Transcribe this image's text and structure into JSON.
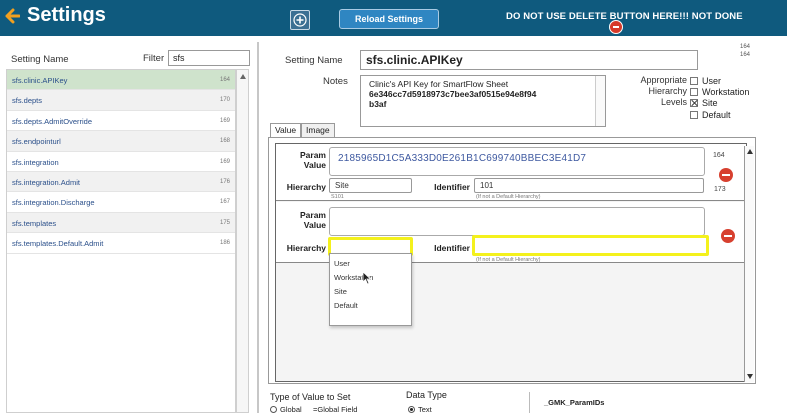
{
  "header": {
    "title": "Settings",
    "reload_label": "Reload Settings",
    "warning": "DO NOT USE DELETE BUTTON HERE!!! NOT DONE"
  },
  "left": {
    "col_label": "Setting Name",
    "filter_label": "Filter",
    "filter_value": "sfs",
    "items": [
      {
        "name": "sfs.clinic.APIKey",
        "num": "164"
      },
      {
        "name": "sfs.depts",
        "num": "170"
      },
      {
        "name": "sfs.depts.AdmitOverride",
        "num": "169"
      },
      {
        "name": "sfs.endpointurl",
        "num": "168"
      },
      {
        "name": "sfs.integration",
        "num": "169"
      },
      {
        "name": "sfs.integration.Admit",
        "num": "176"
      },
      {
        "name": "sfs.integration.Discharge",
        "num": "167"
      },
      {
        "name": "sfs.templates",
        "num": "175"
      },
      {
        "name": "sfs.templates.Default.Admit",
        "num": "186"
      }
    ]
  },
  "detail": {
    "setting_name_label": "Setting Name",
    "setting_name": "sfs.clinic.APIKey",
    "id_top": "164",
    "id_bottom": "164",
    "notes_label": "Notes",
    "notes_line1": "Clinic's API Key for SmartFlow Sheet",
    "notes_line2": "6e346cc7d5918973c7bee3af0515e94e8f94",
    "notes_line3": "b3af",
    "hier_label_1": "Appropriate",
    "hier_label_2": "Hierarchy",
    "hier_label_3": "Levels",
    "levels": [
      {
        "label": "User",
        "checked": false
      },
      {
        "label": "Workstation",
        "checked": false
      },
      {
        "label": "Site",
        "checked": true
      },
      {
        "label": "Default",
        "checked": false
      }
    ]
  },
  "tabs": {
    "value": "Value",
    "image": "Image"
  },
  "records": {
    "param_label_1": "Param",
    "param_label_2": "Value",
    "hierarchy_label": "Hierarchy",
    "identifier_label": "Identifier",
    "hint": "(If not a Default Hierarchy)",
    "rec1": {
      "value": "2185965D1C5A333D0E261B1C699740BBEC3E41D7",
      "hierarchy": "Site",
      "hierarchy_sub": "S101",
      "identifier": "101",
      "num_top": "164",
      "num_bottom": "173"
    }
  },
  "dropdown": {
    "options": [
      "User",
      "Workstation",
      "Site",
      "Default"
    ]
  },
  "bottom": {
    "type_label": "Type of Value to Set",
    "global_label": "Global",
    "global_field": "=Global Field",
    "data_type_label": "Data Type",
    "text_label": "Text",
    "param_ids": "_GMK_ParamIDs"
  }
}
